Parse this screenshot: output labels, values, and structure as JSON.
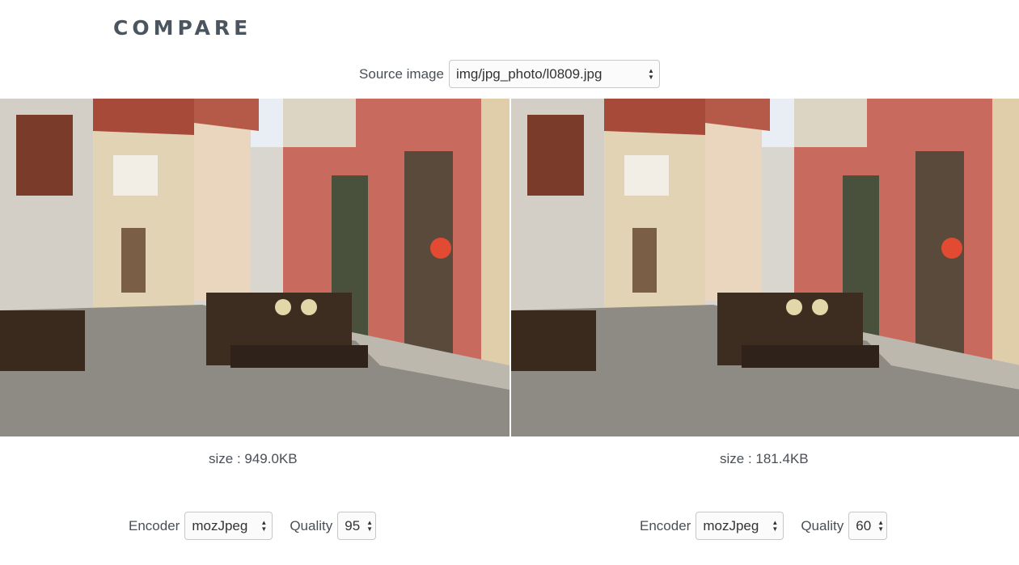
{
  "page": {
    "title": "COMPARE"
  },
  "source": {
    "label": "Source image",
    "value": "img/jpg_photo/l0809.jpg"
  },
  "panels": [
    {
      "size_text": "size : 949.0KB",
      "encoder_label": "Encoder",
      "encoder_value": "mozJpeg",
      "quality_label": "Quality",
      "quality_value": "95"
    },
    {
      "size_text": "size : 181.4KB",
      "encoder_label": "Encoder",
      "encoder_value": "mozJpeg",
      "quality_label": "Quality",
      "quality_value": "60"
    }
  ],
  "icons": {
    "select_arrows": "updown-arrows-icon"
  }
}
